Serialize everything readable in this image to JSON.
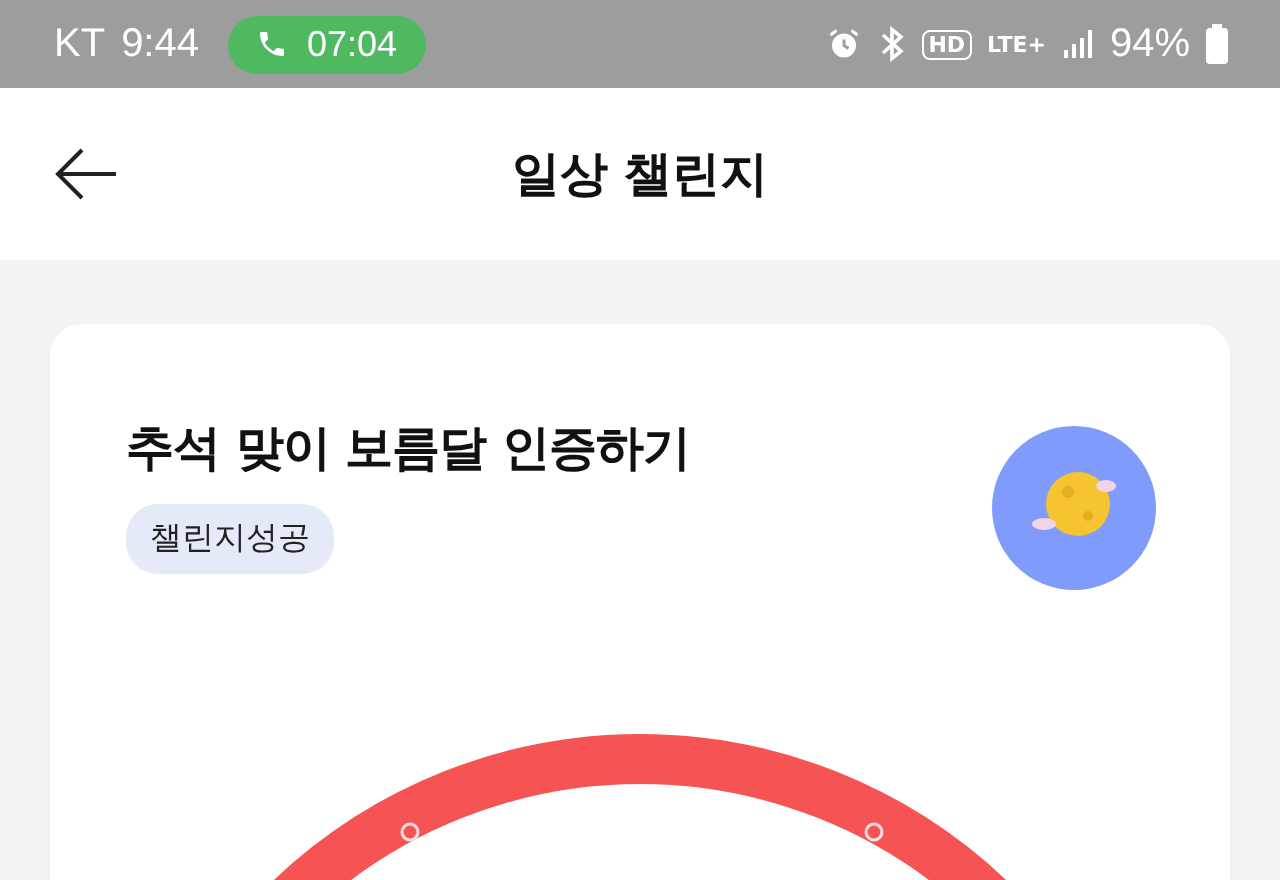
{
  "status_bar": {
    "carrier": "KT",
    "time": "9:44",
    "call_timer": "07:04",
    "hd_label": "HD",
    "network": "LTE+",
    "battery": "94%"
  },
  "header": {
    "title": "일상 챌린지"
  },
  "challenge": {
    "title": "추석 맞이 보름달 인증하기",
    "tag": "챌린지성공"
  }
}
